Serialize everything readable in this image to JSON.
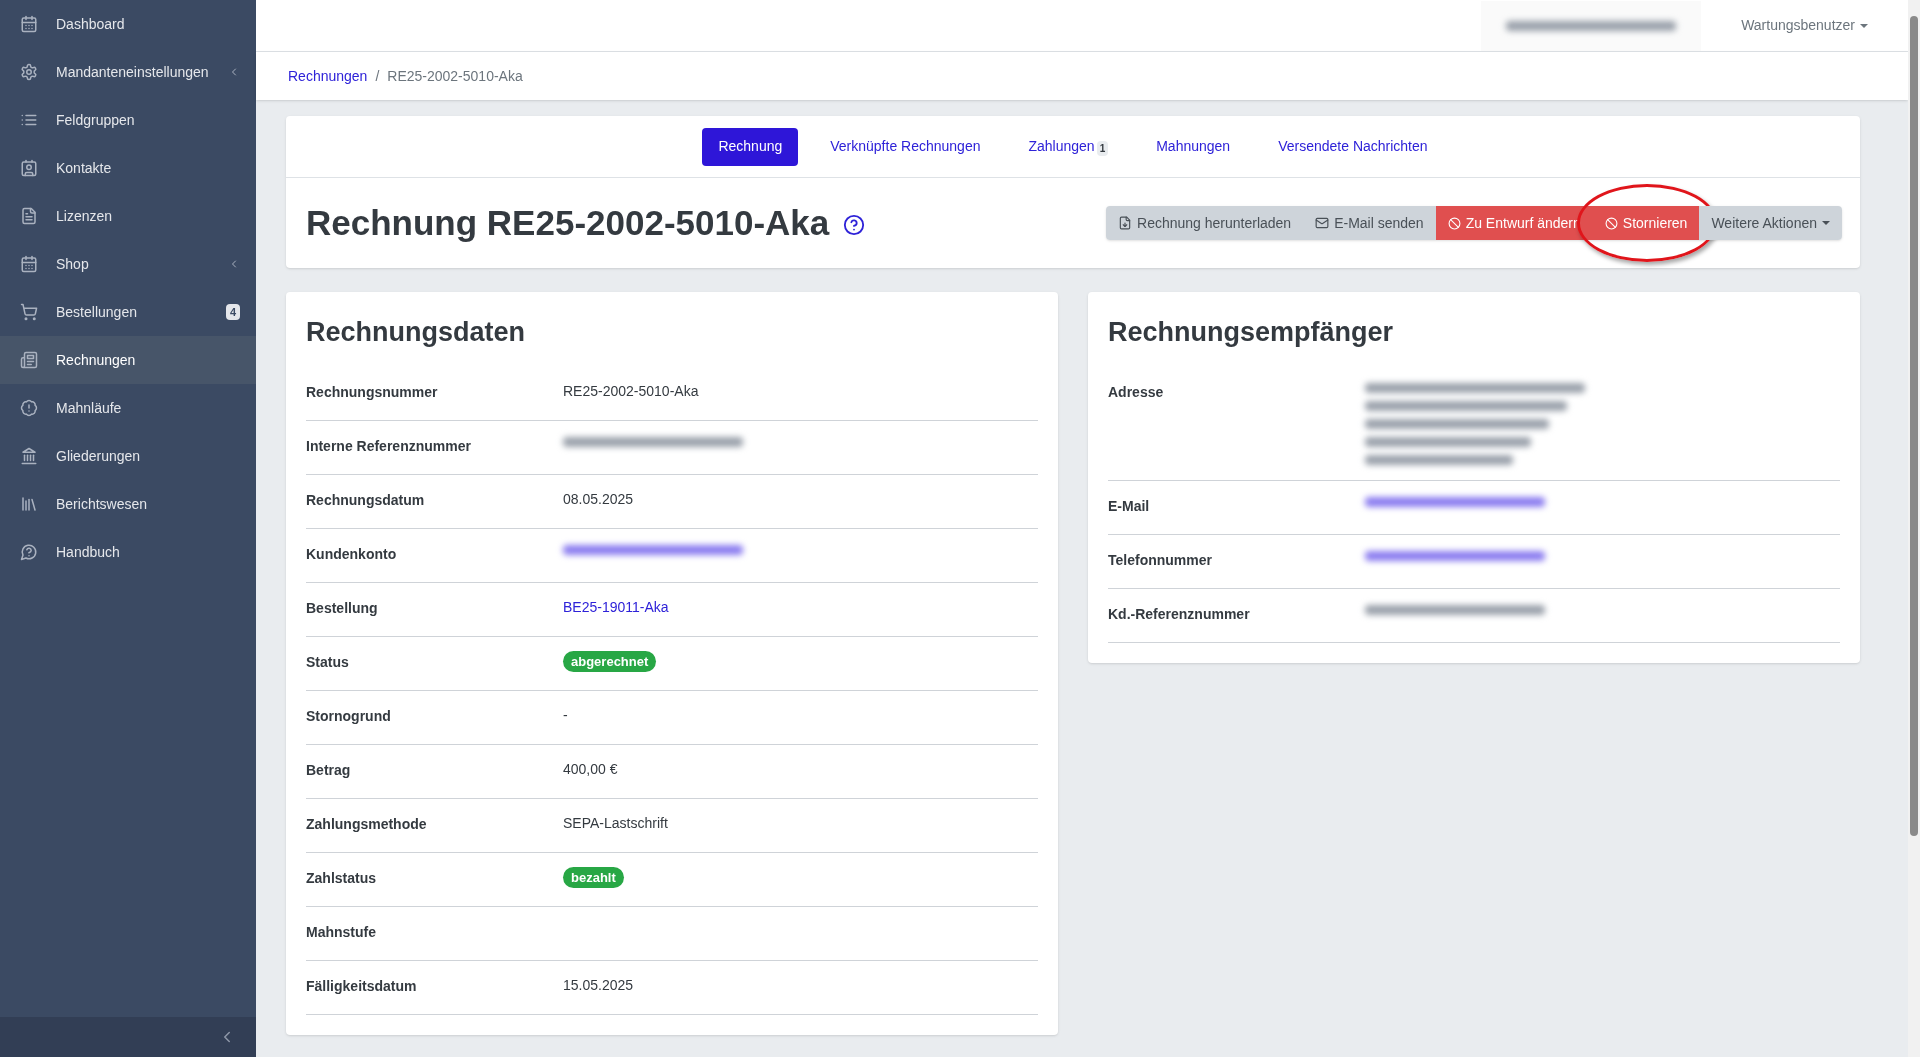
{
  "sidebar": {
    "items": [
      {
        "label": "Dashboard",
        "selected": false,
        "expandable": false
      },
      {
        "label": "Mandanteneinstellungen",
        "selected": false,
        "expandable": true
      },
      {
        "label": "Feldgruppen",
        "selected": false,
        "expandable": false
      },
      {
        "label": "Kontakte",
        "selected": false,
        "expandable": false
      },
      {
        "label": "Lizenzen",
        "selected": false,
        "expandable": false
      },
      {
        "label": "Shop",
        "selected": false,
        "expandable": true
      },
      {
        "label": "Bestellungen",
        "selected": false,
        "expandable": false,
        "badge": "4"
      },
      {
        "label": "Rechnungen",
        "selected": true,
        "expandable": false
      },
      {
        "label": "Mahnläufe",
        "selected": false,
        "expandable": false
      },
      {
        "label": "Gliederungen",
        "selected": false,
        "expandable": false
      },
      {
        "label": "Berichtswesen",
        "selected": false,
        "expandable": false
      },
      {
        "label": "Handbuch",
        "selected": false,
        "expandable": false
      }
    ]
  },
  "topbar": {
    "redacted": true,
    "user": "Wartungsbenutzer"
  },
  "breadcrumb": {
    "separator": "/",
    "items": [
      {
        "label": "Rechnungen",
        "link": true
      },
      {
        "label": "RE25-2002-5010-Aka",
        "link": false
      }
    ]
  },
  "tabs": [
    {
      "label": "Rechnung",
      "selected": true
    },
    {
      "label": "Verknüpfte Rechnungen",
      "selected": false
    },
    {
      "label": "Zahlungen",
      "selected": false,
      "count": "1"
    },
    {
      "label": "Mahnungen",
      "selected": false
    },
    {
      "label": "Versendete Nachrichten",
      "selected": false
    }
  ],
  "title": "Rechnung RE25-2002-5010-Aka",
  "actions": [
    {
      "label": "Rechnung herunterladen",
      "kind": "download",
      "highlighted": false
    },
    {
      "label": "E-Mail senden",
      "kind": "mail",
      "highlighted": false
    },
    {
      "label": "Zu Entwurf ändern",
      "kind": "danger",
      "highlighted": false
    },
    {
      "label": "Stornieren",
      "kind": "danger",
      "highlighted": true
    },
    {
      "label": "Weitere Aktionen",
      "kind": "menu",
      "highlighted": false
    }
  ],
  "invoice_data": {
    "heading": "Rechnungsdaten",
    "rows": [
      {
        "label": "Rechnungsnummer",
        "kind": "text",
        "value": "RE25-2002-5010-Aka"
      },
      {
        "label": "Interne Referenznummer",
        "kind": "redacted"
      },
      {
        "label": "Rechnungsdatum",
        "kind": "text",
        "value": "08.05.2025"
      },
      {
        "label": "Kundenkonto",
        "kind": "redacted_link"
      },
      {
        "label": "Bestellung",
        "kind": "link",
        "value": "BE25-19011-Aka"
      },
      {
        "label": "Status",
        "kind": "badge",
        "value": "abgerechnet"
      },
      {
        "label": "Stornogrund",
        "kind": "text",
        "value": "-"
      },
      {
        "label": "Betrag",
        "kind": "text",
        "value": "400,00 €"
      },
      {
        "label": "Zahlungsmethode",
        "kind": "text",
        "value": "SEPA-Lastschrift"
      },
      {
        "label": "Zahlstatus",
        "kind": "badge",
        "value": "bezahlt"
      },
      {
        "label": "Mahnstufe",
        "kind": "empty"
      },
      {
        "label": "Fälligkeitsdatum",
        "kind": "text",
        "value": "15.05.2025"
      }
    ]
  },
  "recipient": {
    "heading": "Rechnungsempfänger",
    "rows": [
      {
        "label": "Adresse",
        "kind": "redacted_address"
      },
      {
        "label": "E-Mail",
        "kind": "redacted_link"
      },
      {
        "label": "Telefonnummer",
        "kind": "redacted_link"
      },
      {
        "label": "Kd.-Referenznummer",
        "kind": "redacted"
      }
    ]
  }
}
